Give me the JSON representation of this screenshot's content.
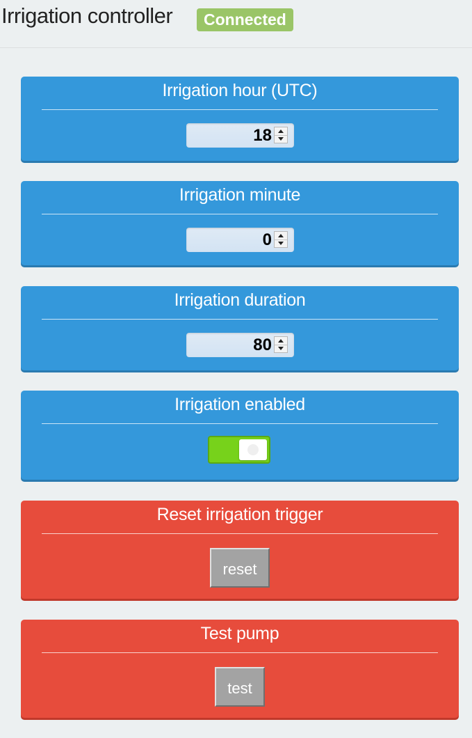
{
  "header": {
    "title": "Irrigation controller",
    "status": "Connected",
    "status_color": "#9ac567"
  },
  "cards": [
    {
      "title": "Irrigation hour (UTC)",
      "control": "number",
      "value": "18",
      "color": "#3498db"
    },
    {
      "title": "Irrigation minute",
      "control": "number",
      "value": "0",
      "color": "#3498db"
    },
    {
      "title": "Irrigation duration",
      "control": "number",
      "value": "80",
      "color": "#3498db"
    },
    {
      "title": "Irrigation enabled",
      "control": "toggle",
      "value": "on",
      "color": "#3498db"
    },
    {
      "title": "Reset irrigation trigger",
      "control": "button",
      "button_label": "reset",
      "color": "#e74c3c"
    },
    {
      "title": "Test pump",
      "control": "button",
      "button_label": "test",
      "color": "#e74c3c"
    }
  ],
  "icons": {
    "spin_up": "triangle-up-icon",
    "spin_down": "triangle-down-icon"
  }
}
